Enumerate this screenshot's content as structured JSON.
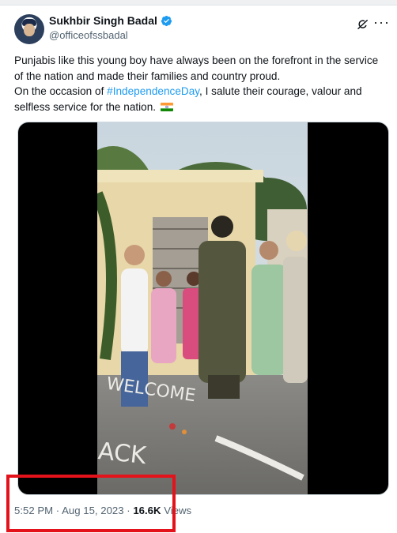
{
  "author": {
    "name": "Sukhbir Singh Badal",
    "handle": "@officeofssbadal"
  },
  "tweet": {
    "line1": "Punjabis like this young boy have always been on the forefront in the service of the nation and made their families and country proud.",
    "line2_before": "On the occasion of ",
    "hashtag": "#IndependenceDay",
    "line2_after": ", I salute their courage, valour and selfless service for the nation."
  },
  "meta": {
    "time": "5:52 PM",
    "sep1": " · ",
    "date": "Aug 15, 2023",
    "sep2": " · ",
    "views_count": "16.6K",
    "views_label": " Views"
  },
  "icons": {
    "verified": "verified-badge-icon",
    "grok": "grok-icon",
    "more": "more-options-icon",
    "flag": "india-flag-icon"
  },
  "colors": {
    "link": "#1d9bf0",
    "secondary_text": "#536471",
    "highlight": "#e3121b"
  }
}
